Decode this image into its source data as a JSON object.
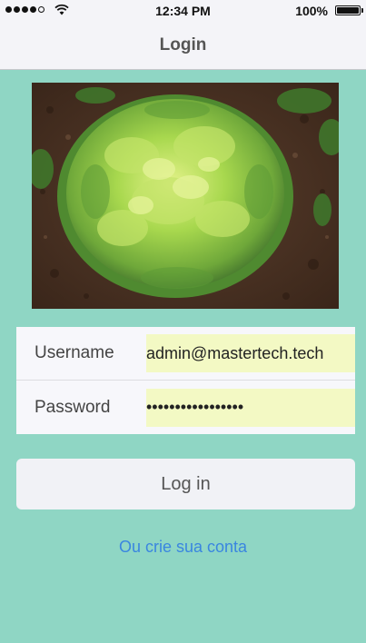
{
  "status_bar": {
    "time": "12:34 PM",
    "battery": "100%",
    "signal_icon": "signal-strength-icon",
    "wifi_icon": "wifi-icon",
    "battery_icon": "battery-icon"
  },
  "nav": {
    "title": "Login"
  },
  "hero": {
    "image_icon": "lettuce-image"
  },
  "form": {
    "username_label": "Username",
    "username_value": "admin@mastertech.tech",
    "password_label": "Password",
    "password_value": "•••••••••••••••••"
  },
  "actions": {
    "login_label": "Log in",
    "create_account_label": "Ou crie sua conta"
  },
  "colors": {
    "background": "#8fd6c4",
    "input_highlight": "#f3f9c4",
    "link": "#3a86e0"
  }
}
